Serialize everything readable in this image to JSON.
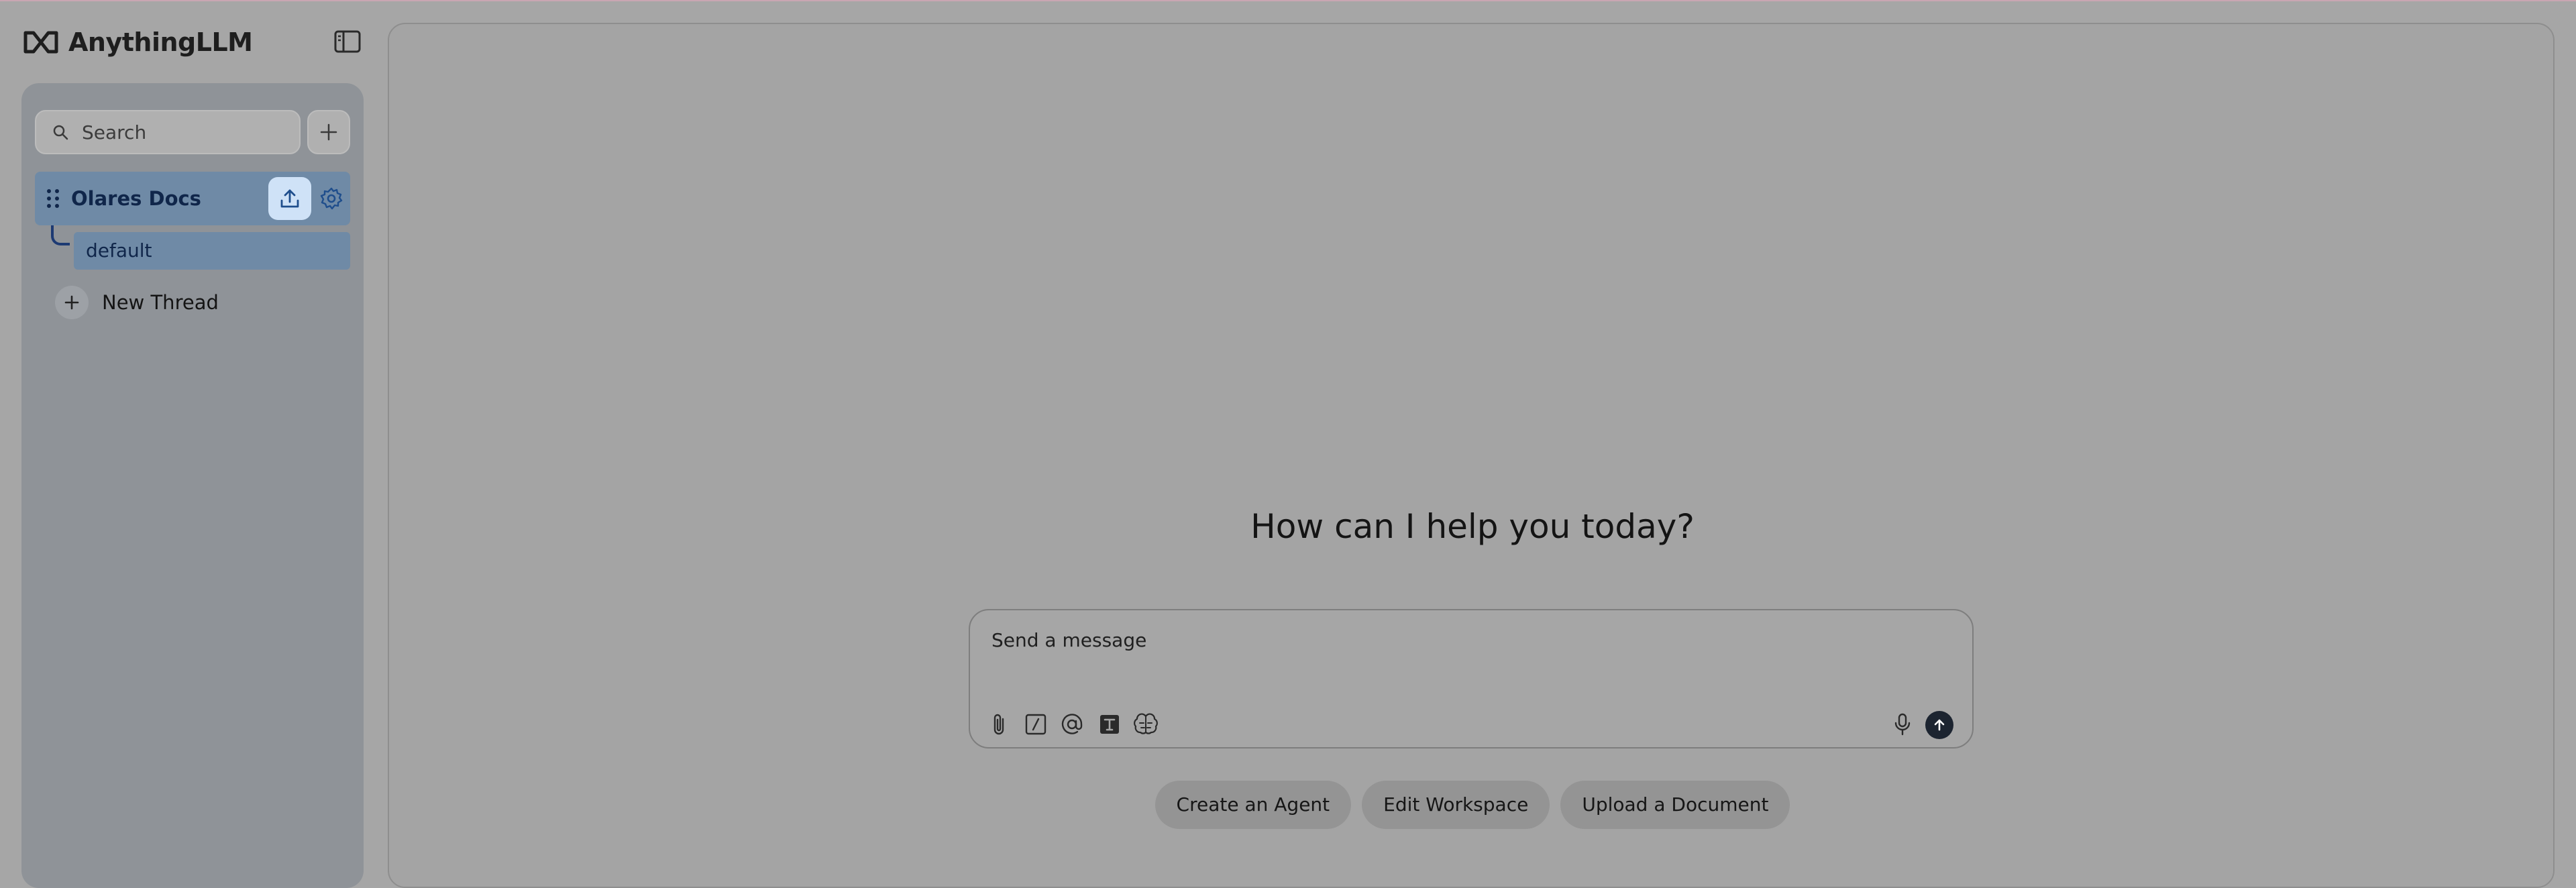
{
  "app": {
    "brand_name": "AnythingLLM",
    "brand_icon": "infinity-logo-icon"
  },
  "sidebar": {
    "toggle_icon": "sidebar-toggle-icon",
    "search": {
      "placeholder": "Search",
      "value": ""
    },
    "add_workspace_icon": "plus-icon",
    "workspaces": [
      {
        "name": "Olares Docs",
        "threads": [
          {
            "label": "default"
          }
        ],
        "actions": [
          "upload-icon",
          "gear-icon"
        ]
      }
    ],
    "new_thread_label": "New Thread"
  },
  "main": {
    "greeting": "How can I help you today?",
    "composer": {
      "placeholder": "Send a message",
      "tools": [
        "paperclip-icon",
        "slash-command-icon",
        "at-mention-icon",
        "text-size-icon",
        "brain-icon"
      ],
      "mic_icon": "microphone-icon",
      "send_icon": "send-arrow-icon"
    },
    "suggestions": [
      {
        "label": "Create an Agent"
      },
      {
        "label": "Edit Workspace"
      },
      {
        "label": "Upload a Document"
      }
    ]
  },
  "colors": {
    "accent": "#1d3a73",
    "active_row": "#6f8aa6",
    "upload_button": "#cfe2f7",
    "send_button": "#1c2430"
  }
}
